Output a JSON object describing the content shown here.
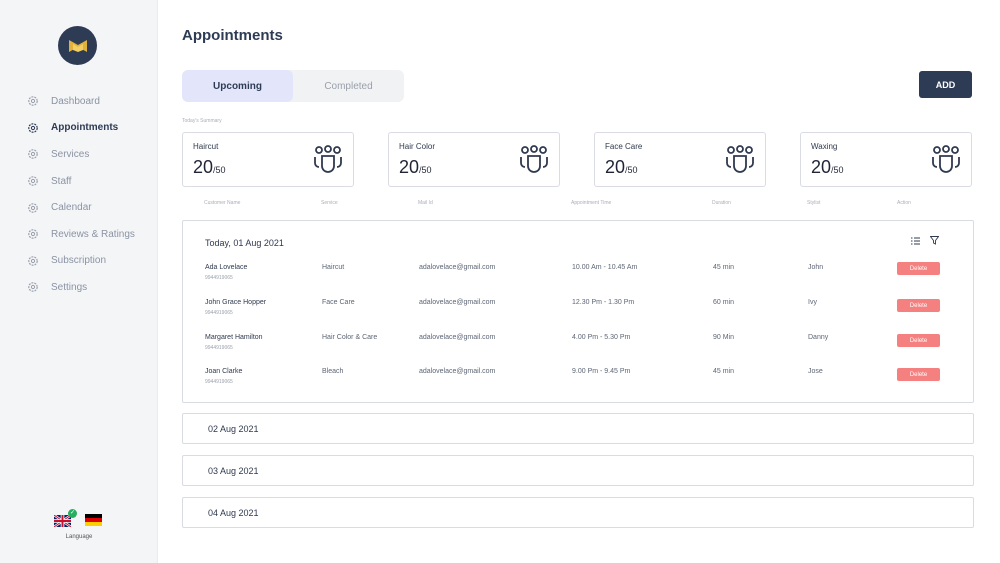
{
  "sidebar": {
    "items": [
      {
        "label": "Dashboard",
        "active": false
      },
      {
        "label": "Appointments",
        "active": true
      },
      {
        "label": "Services",
        "active": false
      },
      {
        "label": "Staff",
        "active": false
      },
      {
        "label": "Calendar",
        "active": false
      },
      {
        "label": "Reviews & Ratings",
        "active": false
      },
      {
        "label": "Subscription",
        "active": false
      },
      {
        "label": "Settings",
        "active": false
      }
    ],
    "language_label": "Language"
  },
  "page": {
    "title": "Appointments",
    "tabs": [
      {
        "label": "Upcoming"
      },
      {
        "label": "Completed"
      }
    ],
    "add_label": "ADD",
    "summary_label": "Today's Summary"
  },
  "summary": [
    {
      "title": "Haircut",
      "count": "20",
      "total": "/50"
    },
    {
      "title": "Hair Color",
      "count": "20",
      "total": "/50"
    },
    {
      "title": "Face Care",
      "count": "20",
      "total": "/50"
    },
    {
      "title": "Waxing",
      "count": "20",
      "total": "/50"
    }
  ],
  "columns": [
    "Customer Name",
    "Service",
    "Mail Id",
    "Appointment Time",
    "Duration",
    "Stylist",
    "Action"
  ],
  "today": {
    "title": "Today, 01 Aug 2021",
    "rows": [
      {
        "name": "Ada Lovelace",
        "phone": "9944919065",
        "service": "Haircut",
        "mail": "adalovelace@gmail.com",
        "time": "10.00 Am - 10.45 Am",
        "duration": "45 min",
        "stylist": "John",
        "action": "Delete"
      },
      {
        "name": "John Grace Hopper",
        "phone": "9944919065",
        "service": "Face Care",
        "mail": "adalovelace@gmail.com",
        "time": "12.30 Pm - 1.30 Pm",
        "duration": "60 min",
        "stylist": "Ivy",
        "action": "Delete"
      },
      {
        "name": "Margaret Hamilton",
        "phone": "9944919065",
        "service": "Hair Color & Care",
        "mail": "adalovelace@gmail.com",
        "time": "4.00 Pm - 5.30 Pm",
        "duration": "90 Min",
        "stylist": "Danny",
        "action": "Delete"
      },
      {
        "name": "Joan Clarke",
        "phone": "9944919065",
        "service": "Bleach",
        "mail": "adalovelace@gmail.com",
        "time": "9.00 Pm - 9.45 Pm",
        "duration": "45 min",
        "stylist": "Jose",
        "action": "Delete"
      }
    ]
  },
  "other_dates": [
    "02 Aug 2021",
    "03 Aug 2021",
    "04 Aug 2021"
  ],
  "colors": {
    "accent": "#2e3b55",
    "delete": "#f58080",
    "tab_active": "#e3e6fa"
  }
}
